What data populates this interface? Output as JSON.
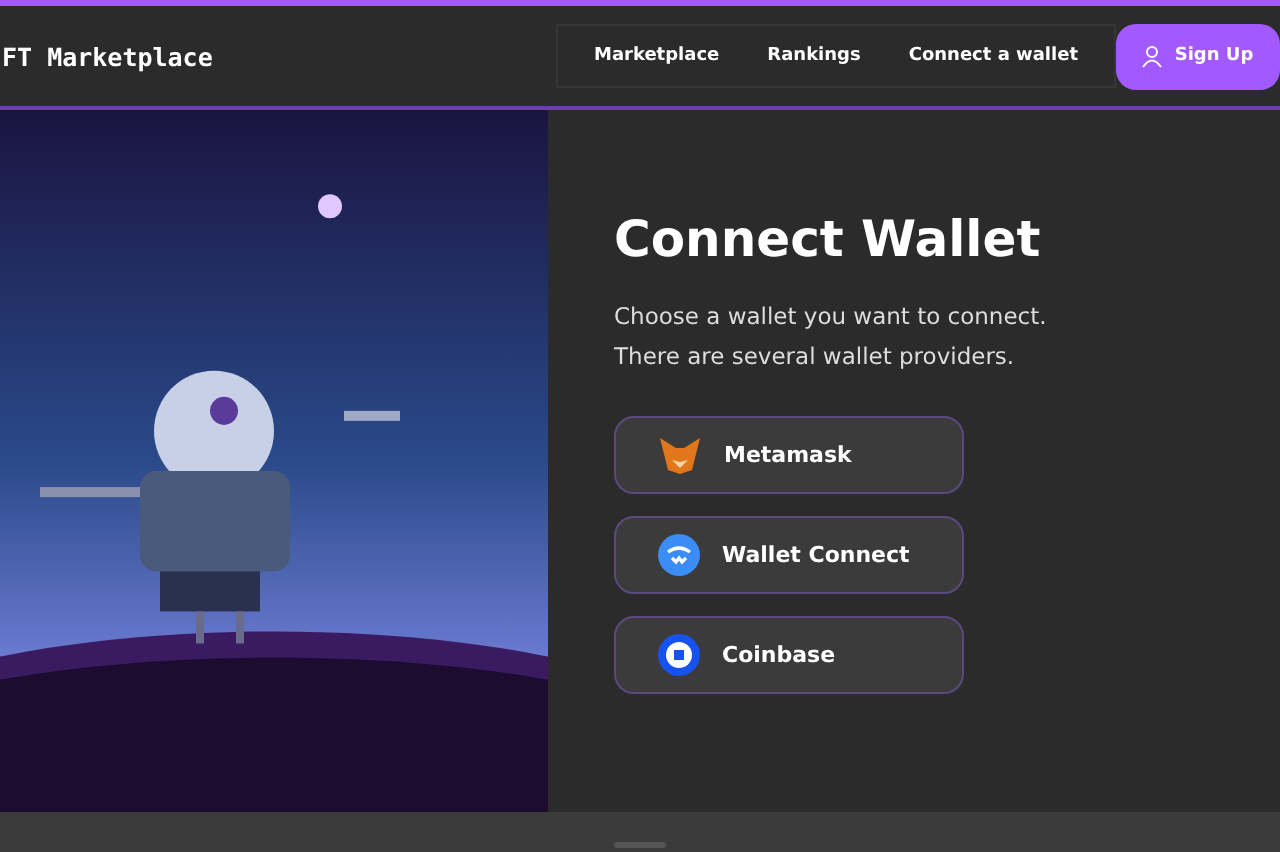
{
  "header": {
    "logo": "FT Marketplace",
    "nav": [
      "Marketplace",
      "Rankings",
      "Connect a wallet"
    ],
    "signup": "Sign Up"
  },
  "connect": {
    "title": "Connect Wallet",
    "lines": [
      "Choose a wallet you want to connect.",
      "There are several wallet providers."
    ],
    "wallets": [
      {
        "kind": "fox",
        "label": "Metamask"
      },
      {
        "kind": "wave",
        "label": "Wallet Connect"
      },
      {
        "kind": "coin",
        "label": "Coinbase"
      }
    ]
  }
}
